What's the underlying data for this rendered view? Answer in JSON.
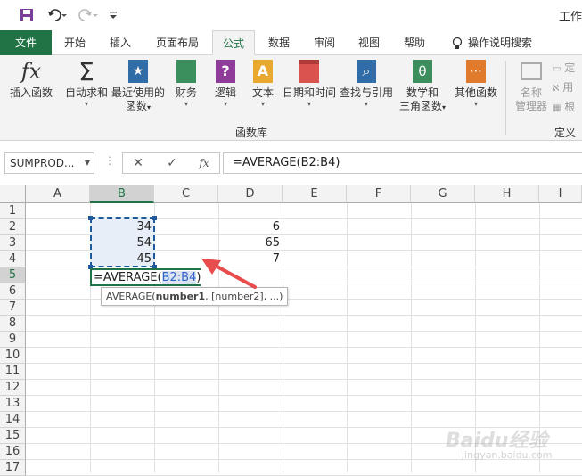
{
  "window": {
    "title_partial": "工作"
  },
  "quick_access": {
    "save_icon": "save-icon",
    "undo_icon": "undo-icon",
    "redo_icon": "redo-icon",
    "customize_icon": "customize-icon"
  },
  "tabs": [
    {
      "label": "文件",
      "kind": "file"
    },
    {
      "label": "开始"
    },
    {
      "label": "插入"
    },
    {
      "label": "页面布局"
    },
    {
      "label": "公式",
      "active": true
    },
    {
      "label": "数据"
    },
    {
      "label": "审阅"
    },
    {
      "label": "视图"
    },
    {
      "label": "帮助"
    },
    {
      "label": "操作说明搜索"
    }
  ],
  "ribbon": {
    "buttons": [
      {
        "line1": "插入函数",
        "line2": "",
        "icon": "fx"
      },
      {
        "line1": "自动求和",
        "line2": "",
        "icon": "Σ"
      },
      {
        "line1": "最近使用的",
        "line2": "函数",
        "icon": "★"
      },
      {
        "line1": "财务",
        "line2": "",
        "icon": "▤"
      },
      {
        "line1": "逻辑",
        "line2": "",
        "icon": "?"
      },
      {
        "line1": "文本",
        "line2": "",
        "icon": "A"
      },
      {
        "line1": "日期和时间",
        "line2": "",
        "icon": "▦"
      },
      {
        "line1": "查找与引用",
        "line2": "",
        "icon": "⌕"
      },
      {
        "line1": "数学和",
        "line2": "三角函数",
        "icon": "θ"
      },
      {
        "line1": "其他函数",
        "line2": "",
        "icon": "⋯"
      },
      {
        "line1": "名称",
        "line2": "管理器",
        "icon": "▣"
      }
    ],
    "group_label": "函数库",
    "group_label2": "定义",
    "side_items": [
      "定",
      "用",
      "根"
    ]
  },
  "formula_bar": {
    "name_box": "SUMPROD...",
    "cancel": "✕",
    "enter": "✓",
    "fx": "fx",
    "formula": "=AVERAGE(B2:B4)"
  },
  "grid": {
    "columns": [
      "A",
      "B",
      "C",
      "D",
      "E",
      "F",
      "G",
      "H",
      "I"
    ],
    "rows": [
      "1",
      "2",
      "3",
      "4",
      "5",
      "6",
      "7",
      "8",
      "9",
      "10",
      "11",
      "12",
      "13",
      "14",
      "15",
      "16",
      "17"
    ],
    "cells": {
      "B2": "34",
      "B3": "54",
      "B4": "45",
      "D2": "6",
      "D3": "65",
      "D4": "7"
    },
    "edit_prefix": "=AVERAGE(",
    "edit_ref": "B2:B4",
    "edit_suffix": ")",
    "tooltip_fn": "AVERAGE(",
    "tooltip_arg1": "number1",
    "tooltip_rest": ", [number2], ...)"
  },
  "watermark": {
    "text": "Baidu经验",
    "sub": "jingyan.baidu.com"
  },
  "colors": {
    "excel_green": "#217346",
    "range_blue": "#1f5a9e",
    "arrow_red": "#e84c4c"
  }
}
